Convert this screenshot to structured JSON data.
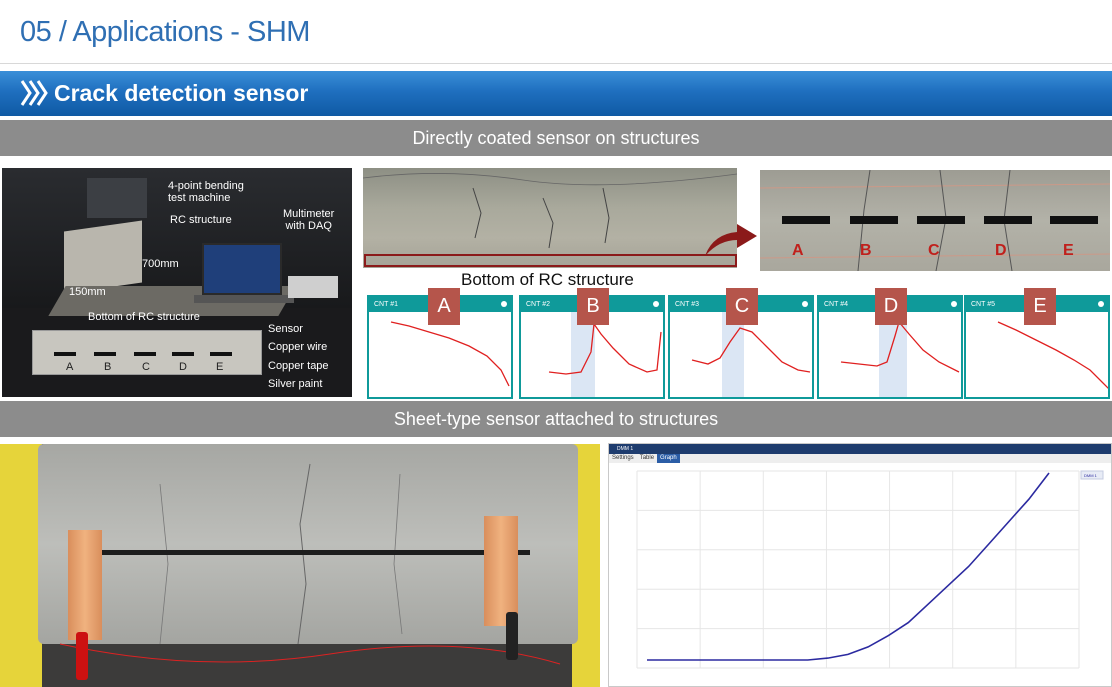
{
  "page": {
    "title": "05 / Applications - SHM",
    "banner": "Crack detection sensor"
  },
  "sections": {
    "top_band": "Directly coated sensor on structures",
    "bottom_band": "Sheet-type sensor attached to structures"
  },
  "lab_photo": {
    "labels": {
      "bending": "4-point bending\ntest machine",
      "rc": "RC structure",
      "multimeter": "Multimeter\nwith DAQ",
      "len700": "700mm",
      "len150": "150mm",
      "bottom": "Bottom of RC structure",
      "sensor": "Sensor",
      "copper_wire": "Copper wire",
      "copper_tape": "Copper tape",
      "silver_paint": "Silver paint"
    },
    "letters": [
      "A",
      "B",
      "C",
      "D",
      "E"
    ]
  },
  "beam_photo": {
    "caption": "Bottom of RC structure",
    "outline_color": "#8b1a1a",
    "arrow_color": "#8b1a1a"
  },
  "closeup_photo": {
    "letters": [
      "A",
      "B",
      "C",
      "D",
      "E"
    ],
    "letter_color": "#c0201c"
  },
  "cnt_graphs": [
    {
      "title": "CNT #1",
      "badge": "A"
    },
    {
      "title": "CNT #2",
      "badge": "B"
    },
    {
      "title": "CNT #3",
      "badge": "C"
    },
    {
      "title": "CNT #4",
      "badge": "D"
    },
    {
      "title": "CNT #5",
      "badge": "E"
    }
  ],
  "graph_window": {
    "title": "DMM 1",
    "tabs": [
      "Settings",
      "Table",
      "Graph"
    ],
    "active_tab": "Graph",
    "legend": "DMM 1"
  },
  "chart_data": [
    {
      "type": "line",
      "title": "",
      "note": "sheet-type sensor resistance vs time (axis tick text illegible)",
      "x": [
        0,
        0.1,
        0.2,
        0.3,
        0.4,
        0.45,
        0.5,
        0.55,
        0.6,
        0.65,
        0.7,
        0.75,
        0.8,
        0.85,
        0.9,
        0.95,
        1.0
      ],
      "y": [
        0.0,
        0.0,
        0.0,
        0.0,
        0.0,
        0.01,
        0.03,
        0.07,
        0.13,
        0.2,
        0.3,
        0.4,
        0.5,
        0.62,
        0.74,
        0.86,
        1.0
      ],
      "color": "#2b2aa0",
      "grid": true,
      "legend_position": "top-right"
    }
  ],
  "colors": {
    "title": "#2f6fb3",
    "banner": "#1f6fbf",
    "band": "#8c8c8c",
    "teal": "#0f9a9a",
    "badge": "#b5554b",
    "series_red": "#e02020"
  }
}
